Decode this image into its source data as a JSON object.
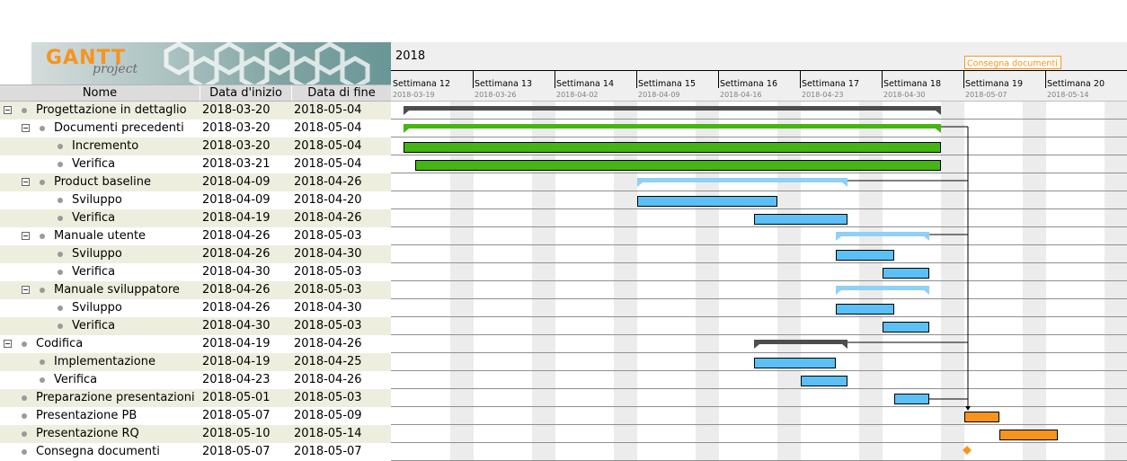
{
  "header": {
    "logo_main": "GANTT",
    "logo_sub": "project",
    "columns": [
      "Nome",
      "Data d'inizio",
      "Data di fine"
    ]
  },
  "timeline": {
    "year": "2018",
    "weeks": [
      {
        "label": "Settimana  12",
        "date": "2018-03-19"
      },
      {
        "label": "Settimana  13",
        "date": "2018-03-26"
      },
      {
        "label": "Settimana  14",
        "date": "2018-04-02"
      },
      {
        "label": "Settimana  15",
        "date": "2018-04-09"
      },
      {
        "label": "Settimana  16",
        "date": "2018-04-16"
      },
      {
        "label": "Settimana  17",
        "date": "2018-04-23"
      },
      {
        "label": "Settimana  18",
        "date": "2018-04-30"
      },
      {
        "label": "Settimana  19",
        "date": "2018-05-07"
      },
      {
        "label": "Settimana  20",
        "date": "2018-05-14"
      }
    ],
    "milestone_label": "Consegna documenti"
  },
  "colors": {
    "summary_dark": "#4d4d4d",
    "green": "#44b513",
    "blue": "#5bc0f5",
    "blue_summary": "#8fd0f7",
    "orange": "#f7941d",
    "weekend": "#ececec"
  },
  "tasks": [
    {
      "name": "Progettazione in dettaglio",
      "start": "2018-03-20",
      "end": "2018-05-04",
      "level": 0,
      "group": true,
      "kind": "summary_dark"
    },
    {
      "name": "Documenti precedenti",
      "start": "2018-03-20",
      "end": "2018-05-04",
      "level": 1,
      "group": true,
      "kind": "summary_green"
    },
    {
      "name": "Incremento",
      "start": "2018-03-20",
      "end": "2018-05-04",
      "level": 2,
      "group": false,
      "kind": "green"
    },
    {
      "name": "Verifica",
      "start": "2018-03-21",
      "end": "2018-05-04",
      "level": 2,
      "group": false,
      "kind": "green"
    },
    {
      "name": "Product baseline",
      "start": "2018-04-09",
      "end": "2018-04-26",
      "level": 1,
      "group": true,
      "kind": "summary_blue"
    },
    {
      "name": "Sviluppo",
      "start": "2018-04-09",
      "end": "2018-04-20",
      "level": 2,
      "group": false,
      "kind": "blue"
    },
    {
      "name": "Verifica",
      "start": "2018-04-19",
      "end": "2018-04-26",
      "level": 2,
      "group": false,
      "kind": "blue"
    },
    {
      "name": "Manuale utente",
      "start": "2018-04-26",
      "end": "2018-05-03",
      "level": 1,
      "group": true,
      "kind": "summary_blue"
    },
    {
      "name": "Sviluppo",
      "start": "2018-04-26",
      "end": "2018-04-30",
      "level": 2,
      "group": false,
      "kind": "blue"
    },
    {
      "name": "Verifica",
      "start": "2018-04-30",
      "end": "2018-05-03",
      "level": 2,
      "group": false,
      "kind": "blue"
    },
    {
      "name": "Manuale sviluppatore",
      "start": "2018-04-26",
      "end": "2018-05-03",
      "level": 1,
      "group": true,
      "kind": "summary_blue"
    },
    {
      "name": "Sviluppo",
      "start": "2018-04-26",
      "end": "2018-04-30",
      "level": 2,
      "group": false,
      "kind": "blue"
    },
    {
      "name": "Verifica",
      "start": "2018-04-30",
      "end": "2018-05-03",
      "level": 2,
      "group": false,
      "kind": "blue"
    },
    {
      "name": "Codifica",
      "start": "2018-04-19",
      "end": "2018-04-26",
      "level": 0,
      "group": true,
      "kind": "summary_dark"
    },
    {
      "name": "Implementazione",
      "start": "2018-04-19",
      "end": "2018-04-25",
      "level": 1,
      "group": false,
      "kind": "blue"
    },
    {
      "name": "Verifica",
      "start": "2018-04-23",
      "end": "2018-04-26",
      "level": 1,
      "group": false,
      "kind": "blue"
    },
    {
      "name": "Preparazione presentazioni",
      "start": "2018-05-01",
      "end": "2018-05-03",
      "level": 0,
      "group": false,
      "kind": "blue"
    },
    {
      "name": "Presentazione PB",
      "start": "2018-05-07",
      "end": "2018-05-09",
      "level": 0,
      "group": false,
      "kind": "orange"
    },
    {
      "name": "Presentazione RQ",
      "start": "2018-05-10",
      "end": "2018-05-14",
      "level": 0,
      "group": false,
      "kind": "orange"
    },
    {
      "name": "Consegna documenti",
      "start": "2018-05-07",
      "end": "2018-05-07",
      "level": 0,
      "group": false,
      "kind": "milestone"
    }
  ]
}
